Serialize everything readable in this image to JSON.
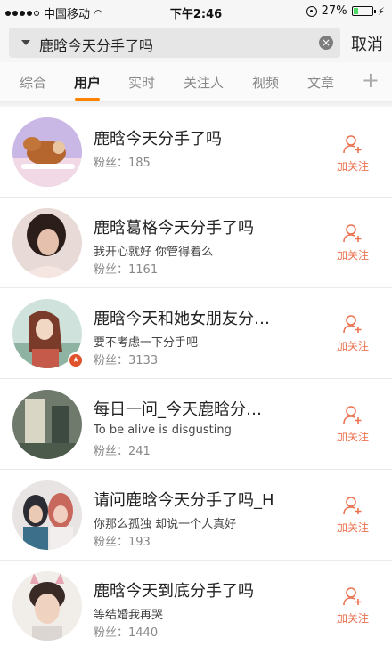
{
  "status_bar": {
    "carrier": "中国移动",
    "time": "下午2:46",
    "battery_percent": "27%",
    "battery_level": 0.27
  },
  "search": {
    "query": "鹿晗今天分手了吗",
    "cancel_label": "取消"
  },
  "tabs": [
    {
      "label": "综合",
      "active": false
    },
    {
      "label": "用户",
      "active": true
    },
    {
      "label": "实时",
      "active": false
    },
    {
      "label": "关注人",
      "active": false
    },
    {
      "label": "视频",
      "active": false
    },
    {
      "label": "文章",
      "active": false
    }
  ],
  "colors": {
    "accent": "#ff8200",
    "follow": "#eb7350"
  },
  "users": [
    {
      "name": "鹿晗今天分手了吗",
      "desc": "",
      "fans": "粉丝：185",
      "follow_label": "加关注"
    },
    {
      "name": "鹿晗葛格今天分手了吗",
      "desc": "我开心就好 你管得着么",
      "fans": "粉丝：1161",
      "follow_label": "加关注"
    },
    {
      "name": "鹿晗今天和她女朋友分…",
      "desc": "要不考虑一下分手吧",
      "fans": "粉丝：3133",
      "follow_label": "加关注"
    },
    {
      "name": "每日一问_今天鹿晗分…",
      "desc": "To be alive is disgusting",
      "fans": "粉丝：241",
      "follow_label": "加关注"
    },
    {
      "name": "请问鹿晗今天分手了吗_H",
      "desc": "你那么孤独 却说一个人真好",
      "fans": "粉丝：193",
      "follow_label": "加关注"
    },
    {
      "name": "鹿晗今天到底分手了吗",
      "desc": "等结婚我再哭",
      "fans": "粉丝：1440",
      "follow_label": "加关注"
    }
  ]
}
